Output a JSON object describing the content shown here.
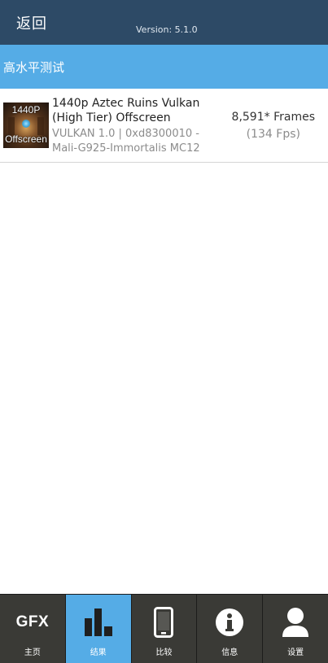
{
  "header": {
    "back_label": "返回",
    "version": "Version: 5.1.0"
  },
  "section": {
    "title": "高水平测试"
  },
  "result": {
    "thumbnail": {
      "line1": "1440P",
      "line2": "Offscreen"
    },
    "name": "1440p Aztec Ruins Vulkan (High Tier) Offscreen",
    "api": "VULKAN 1.0 | 0xd8300010 - Mali-G925-Immortalis MC12",
    "score": "8,591* Frames",
    "fps": "(134 Fps)"
  },
  "nav": {
    "active": "results",
    "tabs": [
      {
        "id": "home",
        "label": "主页",
        "icon": "gfx-logo-icon",
        "logo_text": "GFX"
      },
      {
        "id": "results",
        "label": "结果",
        "icon": "bar-chart-icon"
      },
      {
        "id": "compare",
        "label": "比较",
        "icon": "phone-icon"
      },
      {
        "id": "info",
        "label": "信息",
        "icon": "info-icon"
      },
      {
        "id": "settings",
        "label": "设置",
        "icon": "user-icon"
      }
    ]
  },
  "colors": {
    "topbar": "#2d4a66",
    "accent": "#55ace6",
    "nav_background": "#3a3a36",
    "text_secondary": "#8c8c8c"
  }
}
